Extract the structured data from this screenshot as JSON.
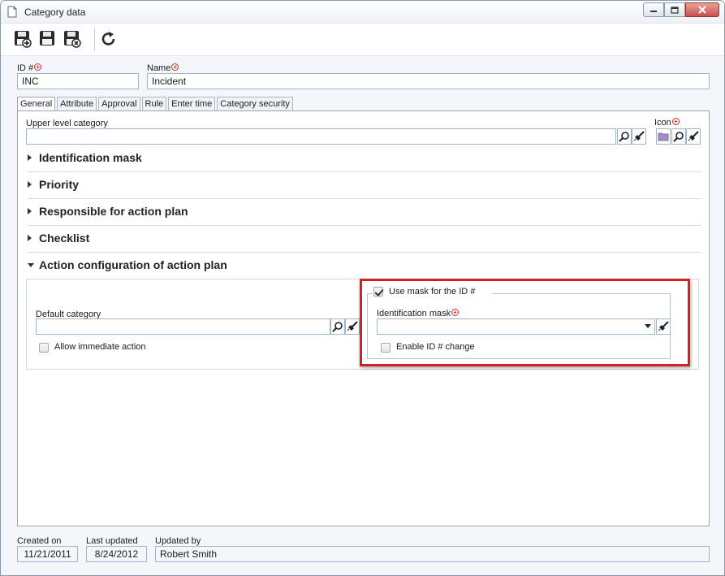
{
  "window": {
    "title": "Category data"
  },
  "toolbar": {
    "items": [
      "save-new-icon",
      "save-icon",
      "save-close-icon",
      "refresh-icon"
    ]
  },
  "header": {
    "id_label": "ID #",
    "id_value": "INC",
    "name_label": "Name",
    "name_value": "Incident"
  },
  "tabs": [
    "General",
    "Attribute",
    "Approval",
    "Rule",
    "Enter time",
    "Category security"
  ],
  "general": {
    "upper_level_label": "Upper level category",
    "upper_level_value": "",
    "icon_label": "Icon",
    "sections": [
      {
        "title": "Identification mask",
        "expanded": false
      },
      {
        "title": "Priority",
        "expanded": false
      },
      {
        "title": "Responsible for action plan",
        "expanded": false
      },
      {
        "title": "Checklist",
        "expanded": false
      },
      {
        "title": "Action configuration of action plan",
        "expanded": true
      }
    ],
    "action_config": {
      "default_category_label": "Default category",
      "default_category_value": "",
      "allow_immediate_label": "Allow immediate action",
      "allow_immediate_checked": false,
      "use_mask_label": "Use mask for the ID #",
      "use_mask_checked": true,
      "identification_mask_label": "Identification mask",
      "identification_mask_value": "",
      "enable_id_change_label": "Enable ID # change",
      "enable_id_change_checked": false
    }
  },
  "footer": {
    "created_on_label": "Created on",
    "created_on_value": "11/21/2011",
    "last_updated_label": "Last updated",
    "last_updated_value": "8/24/2012",
    "updated_by_label": "Updated by",
    "updated_by_value": "Robert Smith"
  },
  "colors": {
    "highlight": "#d42020",
    "field_border": "#9fb6cd",
    "required": "#c0392b"
  }
}
